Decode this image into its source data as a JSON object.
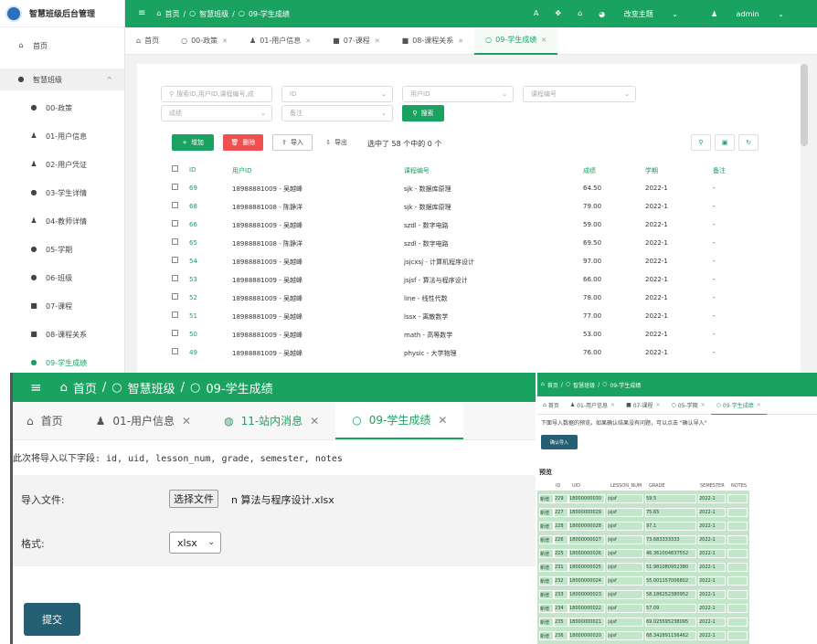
{
  "colors": {
    "accent": "#1aa260",
    "danger": "#f05050",
    "submit": "#255f74",
    "preview_bg": "#c3e6cb"
  },
  "main": {
    "app_title": "智慧班级后台管理",
    "sidebar": {
      "home": "首页",
      "group": "智慧班级",
      "items": [
        "00-政策",
        "01-用户信息",
        "02-用户凭证",
        "03-学生详情",
        "04-教师详情",
        "05-学期",
        "06-班级",
        "07-课程",
        "08-课程关系",
        "09-学生成绩"
      ]
    },
    "topbar": {
      "breadcrumb": [
        "首页",
        "智慧班级",
        "09-学生成绩"
      ],
      "theme": "改变主题",
      "user": "admin"
    },
    "tabs": [
      "首页",
      "00-政策",
      "01-用户信息",
      "07-课程",
      "08-课程关系",
      "09-学生成绩"
    ],
    "filters": {
      "search": "搜索ID,用户ID,课程编号,成",
      "id": "ID",
      "uid": "用户ID",
      "lesson": "课程编号",
      "grade": "成绩",
      "notes": "备注",
      "search_btn": "搜索"
    },
    "toolbar": {
      "add": "增加",
      "delete": "删除",
      "import": "导入",
      "export": "导出",
      "selected": "选中了 58 个中的 0 个"
    },
    "table": {
      "headers": [
        "ID",
        "用户ID",
        "课程编号",
        "成绩",
        "学期",
        "备注"
      ],
      "rows": [
        [
          "69",
          "18988881009 - 吴越峰",
          "sjk - 数据库原理",
          "64.50",
          "2022-1",
          "-"
        ],
        [
          "68",
          "18988881008 - 陈静洋",
          "sjk - 数据库原理",
          "79.00",
          "2022-1",
          "-"
        ],
        [
          "66",
          "18988881009 - 吴越峰",
          "szdl - 数字电路",
          "59.00",
          "2022-1",
          "-"
        ],
        [
          "65",
          "18988881008 - 陈静洋",
          "szdl - 数字电路",
          "69.50",
          "2022-1",
          "-"
        ],
        [
          "54",
          "18988881009 - 吴越峰",
          "jsjcxsj - 计算机程序设计",
          "97.00",
          "2022-1",
          "-"
        ],
        [
          "53",
          "18988881009 - 吴越峰",
          "jsjsf - 算法与程序设计",
          "66.00",
          "2022-1",
          "-"
        ],
        [
          "52",
          "18988881009 - 吴越峰",
          "line - 线性代数",
          "78.00",
          "2022-1",
          "-"
        ],
        [
          "51",
          "18988881009 - 吴越峰",
          "lssx - 离散数学",
          "77.00",
          "2022-1",
          "-"
        ],
        [
          "50",
          "18988881009 - 吴越峰",
          "math - 高等数学",
          "53.00",
          "2022-1",
          "-"
        ],
        [
          "49",
          "18988881009 - 吴越峰",
          "physic - 大学物理",
          "76.00",
          "2022-1",
          "-"
        ]
      ]
    }
  },
  "import": {
    "breadcrumb": [
      "首页",
      "智慧班级",
      "09-学生成绩"
    ],
    "tabs": [
      "首页",
      "01-用户信息",
      "11-站内消息",
      "09-学生成绩"
    ],
    "fields_line": "此次将导入以下字段: id, uid, lesson_num, grade, semester, notes",
    "file_label": "导入文件:",
    "file_button": "选择文件",
    "file_name": "n 算法与程序设计.xlsx",
    "format_label": "格式:",
    "format_value": "xlsx",
    "submit": "提交"
  },
  "preview": {
    "breadcrumb": [
      "首页",
      "智慧班级",
      "09-学生成绩"
    ],
    "tabs": [
      "首页",
      "01-用户信息",
      "07-课程",
      "05-学期",
      "09-学生成绩"
    ],
    "note": "下面导入数据的预览。如果确认结果没有问题，可以点击 \"确认导入\"",
    "confirm": "确认导入",
    "section": "预览",
    "headers": [
      "ID",
      "UID",
      "LESSON_NUM",
      "GRADE",
      "SEMESTER",
      "NOTES"
    ],
    "rows": [
      [
        "新增",
        "229",
        "18000000030",
        "jsjsf",
        "59.5",
        "2022-1"
      ],
      [
        "新增",
        "227",
        "18000000029",
        "jsjsf",
        "75.65",
        "2022-1"
      ],
      [
        "新增",
        "228",
        "18000000028",
        "jsjsf",
        "97.1",
        "2022-1"
      ],
      [
        "新增",
        "226",
        "18000000027",
        "jsjsf",
        "73.683333333",
        "2022-1"
      ],
      [
        "新增",
        "225",
        "18000000026",
        "jsjsf",
        "46.361004837552",
        "2022-1"
      ],
      [
        "新增",
        "231",
        "18000000025",
        "jsjsf",
        "51.981080952380",
        "2022-1"
      ],
      [
        "新增",
        "232",
        "18000000024",
        "jsjsf",
        "55.001157006802",
        "2022-1"
      ],
      [
        "新增",
        "233",
        "18000000023",
        "jsjsf",
        "58.186252380952",
        "2022-1"
      ],
      [
        "新增",
        "234",
        "18000000022",
        "jsjsf",
        "57.09",
        "2022-1"
      ],
      [
        "新增",
        "235",
        "18000000021",
        "jsjsf",
        "69.025595238095",
        "2022-1"
      ],
      [
        "新增",
        "236",
        "18000000020",
        "jsjsf",
        "68.342891156462",
        "2022-1"
      ]
    ]
  }
}
